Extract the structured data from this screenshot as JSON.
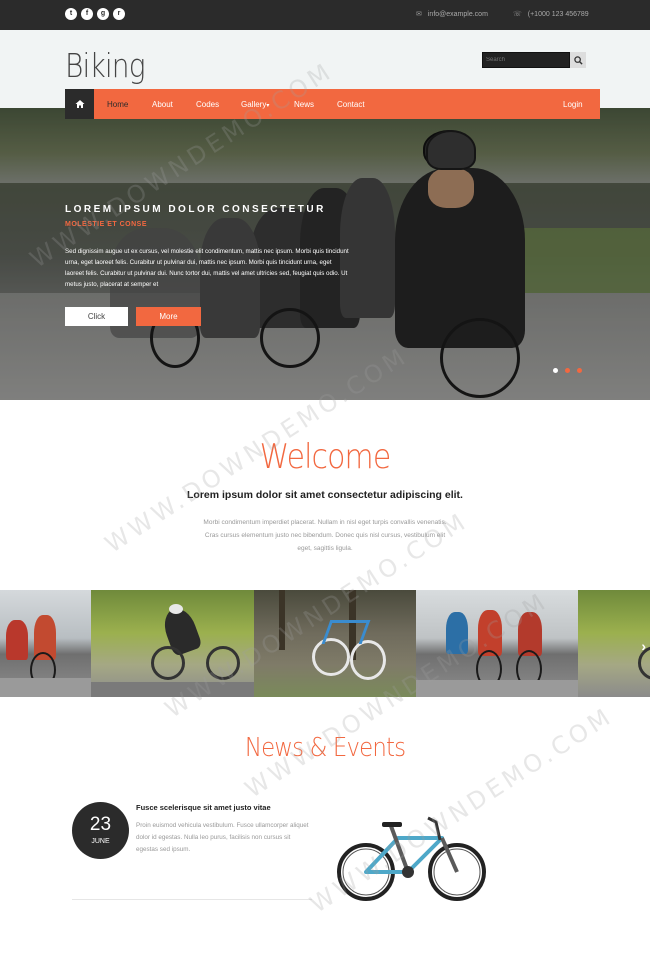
{
  "topbar": {
    "social": [
      {
        "icon": "twitter-icon",
        "glyph": "t"
      },
      {
        "icon": "facebook-icon",
        "glyph": "f"
      },
      {
        "icon": "googleplus-icon",
        "glyph": "g"
      },
      {
        "icon": "rss-icon",
        "glyph": "r"
      }
    ],
    "email": "info@example.com",
    "phone": "(+1000 123 456789"
  },
  "header": {
    "logo": "Biking",
    "search_placeholder": "Search"
  },
  "nav": {
    "items": [
      "Home",
      "About",
      "Codes",
      "Gallery",
      "News",
      "Contact"
    ],
    "gallery_caret": "▾",
    "login": "Login"
  },
  "hero": {
    "title": "LOREM IPSUM DOLOR CONSECTETUR",
    "subtitle": "MOLESTIE ET CONSE",
    "text": "Sed dignissim augue ut ex cursus, vel molestie elit condimentum, mattis nec ipsum. Morbi quis tincidunt urna, eget laoreet felis. Curabitur ut pulvinar dui, mattis nec ipsum. Morbi quis tincidunt urna, eget laoreet felis. Curabitur ut pulvinar dui. Nunc tortor dui, mattis vel amet ultricies sed, feugiat quis odio. Ut metus justo, placerat at semper et",
    "btn_click": "Click",
    "btn_more": "More",
    "slides": 3,
    "active_slide": 1
  },
  "welcome": {
    "title": "Welcome",
    "lead": "Lorem ipsum dolor sit amet consectetur adipiscing elit.",
    "text": "Morbi condimentum imperdiet placerat. Nullam in nisl eget turpis convallis venenatis. Cras cursus elementum justo nec bibendum. Donec quis nisl cursus, vestibulum elit eget, sagittis ligula."
  },
  "gallery": {
    "next_arrow": "›"
  },
  "news": {
    "title": "News & Events",
    "day": "23",
    "month": "JUNE",
    "headline": "Fusce scelerisque sit amet justo vitae",
    "text": "Proin euismod vehicula vestibulum. Fusce ullamcorper aliquet dolor id egestas. Nulla leo purus, facilisis non cursus sit egestas sed ipsum."
  },
  "watermark": "WWW.DOWNDEMO.COM",
  "colors": {
    "accent": "#f26840",
    "dark": "#2b2b2b",
    "header_bg": "#f1f4f4"
  }
}
